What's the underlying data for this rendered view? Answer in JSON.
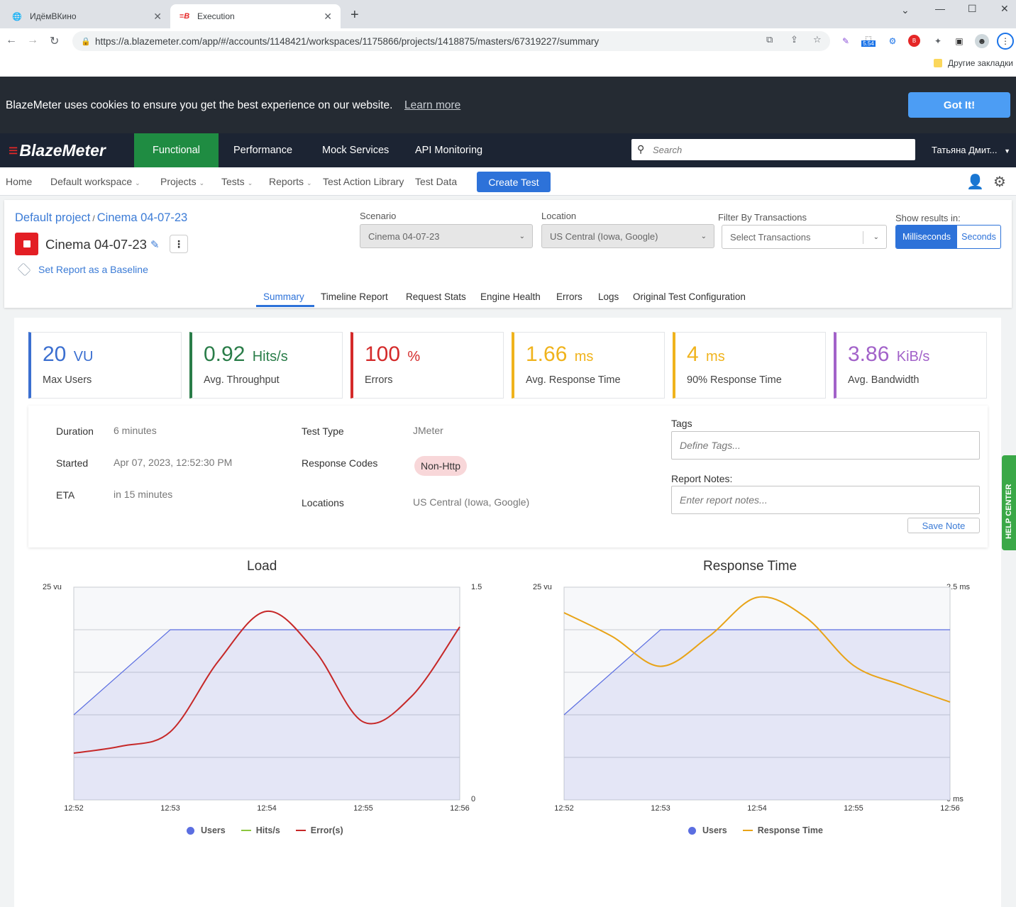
{
  "browser": {
    "tabs": [
      {
        "title": "ИдёмВКино",
        "active": false
      },
      {
        "title": "Execution",
        "active": true
      }
    ],
    "url": "https://a.blazemeter.com/app/#/accounts/1148421/workspaces/1175866/projects/1418875/masters/67319227/summary",
    "extension_badge": "5.54",
    "bookmark": "Другие закладки"
  },
  "cookie_banner": {
    "text": "BlazeMeter uses cookies to ensure you get the best experience on our website.",
    "link": "Learn more",
    "button": "Got It!"
  },
  "main_nav": {
    "logo": "BlazeMeter",
    "items": [
      "Functional",
      "Performance",
      "Mock Services",
      "API Monitoring"
    ],
    "active": "Functional",
    "search_placeholder": "Search",
    "user": "Татьяна Дмит..."
  },
  "sub_nav": {
    "items": [
      "Home",
      "Default workspace",
      "Projects",
      "Tests",
      "Reports",
      "Test Action Library",
      "Test Data"
    ],
    "create_button": "Create Test"
  },
  "header": {
    "breadcrumb": [
      "Default project",
      "Cinema 04-07-23"
    ],
    "test_name": "Cinema 04-07-23",
    "baseline_link": "Set Report as a Baseline",
    "scenario_label": "Scenario",
    "scenario_value": "Cinema 04-07-23",
    "location_label": "Location",
    "location_value": "US Central (Iowa, Google)",
    "filter_label": "Filter By Transactions",
    "filter_placeholder": "Select Transactions",
    "results_label": "Show results in:",
    "unit_options": [
      "Milliseconds",
      "Seconds"
    ],
    "unit_selected": "Milliseconds",
    "report_tabs": [
      "Summary",
      "Timeline Report",
      "Request Stats",
      "Engine Health",
      "Errors",
      "Logs",
      "Original Test Configuration"
    ],
    "active_tab": "Summary"
  },
  "kpis": [
    {
      "value": "20",
      "unit": "VU",
      "label": "Max Users",
      "color": "#3b6fd0"
    },
    {
      "value": "0.92",
      "unit": "Hits/s",
      "label": "Avg. Throughput",
      "color": "#2a7d49"
    },
    {
      "value": "100",
      "unit": "%",
      "label": "Errors",
      "color": "#d42a2a"
    },
    {
      "value": "1.66",
      "unit": "ms",
      "label": "Avg. Response Time",
      "color": "#f0b31c"
    },
    {
      "value": "4",
      "unit": "ms",
      "label": "90% Response Time",
      "color": "#f0b31c"
    },
    {
      "value": "3.86",
      "unit": "KiB/s",
      "label": "Avg. Bandwidth",
      "color": "#a262c9"
    }
  ],
  "info": {
    "duration_label": "Duration",
    "duration": "6 minutes",
    "started_label": "Started",
    "started": "Apr 07, 2023, 12:52:30 PM",
    "eta_label": "ETA",
    "eta": "in 15 minutes",
    "test_type_label": "Test Type",
    "test_type": "JMeter",
    "response_codes_label": "Response Codes",
    "response_code": "Non-Http",
    "locations_label": "Locations",
    "locations": "US Central (Iowa, Google)",
    "tags_label": "Tags",
    "tags_placeholder": "Define Tags...",
    "notes_label": "Report Notes:",
    "notes_placeholder": "Enter report notes...",
    "save_note": "Save Note"
  },
  "help_center": "HELP CENTER",
  "chart_data": [
    {
      "type": "line",
      "title": "Load",
      "x": [
        "12:52",
        "12:53",
        "12:54",
        "12:55",
        "12:56"
      ],
      "y_left_label_top": "25 vu",
      "y_right_labels": [
        "1.5",
        "0"
      ],
      "ylim_left": [
        0,
        25
      ],
      "ylim_right": [
        0,
        1.5
      ],
      "grid": true,
      "series": [
        {
          "name": "Users",
          "axis": "left",
          "color": "#5b6ee1",
          "points": [
            [
              0,
              10
            ],
            [
              1,
              20
            ],
            [
              2,
              20
            ],
            [
              3,
              20
            ],
            [
              4,
              20
            ]
          ]
        },
        {
          "name": "Hits/s",
          "axis": "right",
          "color": "#8cc63e",
          "points": []
        },
        {
          "name": "Error(s)",
          "axis": "right",
          "color": "#c62828",
          "points": [
            [
              0,
              0.33
            ],
            [
              0.5,
              0.38
            ],
            [
              1,
              0.48
            ],
            [
              1.5,
              0.98
            ],
            [
              2,
              1.33
            ],
            [
              2.5,
              1.05
            ],
            [
              3,
              0.55
            ],
            [
              3.5,
              0.73
            ],
            [
              4,
              1.22
            ]
          ]
        }
      ],
      "legend": [
        "Users",
        "Hits/s",
        "Error(s)"
      ]
    },
    {
      "type": "line",
      "title": "Response Time",
      "x": [
        "12:52",
        "12:53",
        "12:54",
        "12:55",
        "12:56"
      ],
      "y_left_label_top": "25 vu",
      "y_right_labels": [
        "2.5 ms",
        "0 ms"
      ],
      "ylim_left": [
        0,
        25
      ],
      "ylim_right": [
        0,
        2.5
      ],
      "grid": true,
      "series": [
        {
          "name": "Users",
          "axis": "left",
          "color": "#5b6ee1",
          "points": [
            [
              0,
              10
            ],
            [
              1,
              20
            ],
            [
              2,
              20
            ],
            [
              3,
              20
            ],
            [
              4,
              20
            ]
          ]
        },
        {
          "name": "Response Time",
          "axis": "right",
          "color": "#e8a317",
          "points": [
            [
              0,
              2.2
            ],
            [
              0.5,
              1.92
            ],
            [
              1,
              1.57
            ],
            [
              1.5,
              1.92
            ],
            [
              2,
              2.38
            ],
            [
              2.5,
              2.15
            ],
            [
              3,
              1.58
            ],
            [
              3.5,
              1.35
            ],
            [
              4,
              1.15
            ]
          ]
        }
      ],
      "legend": [
        "Users",
        "Response Time"
      ]
    }
  ]
}
